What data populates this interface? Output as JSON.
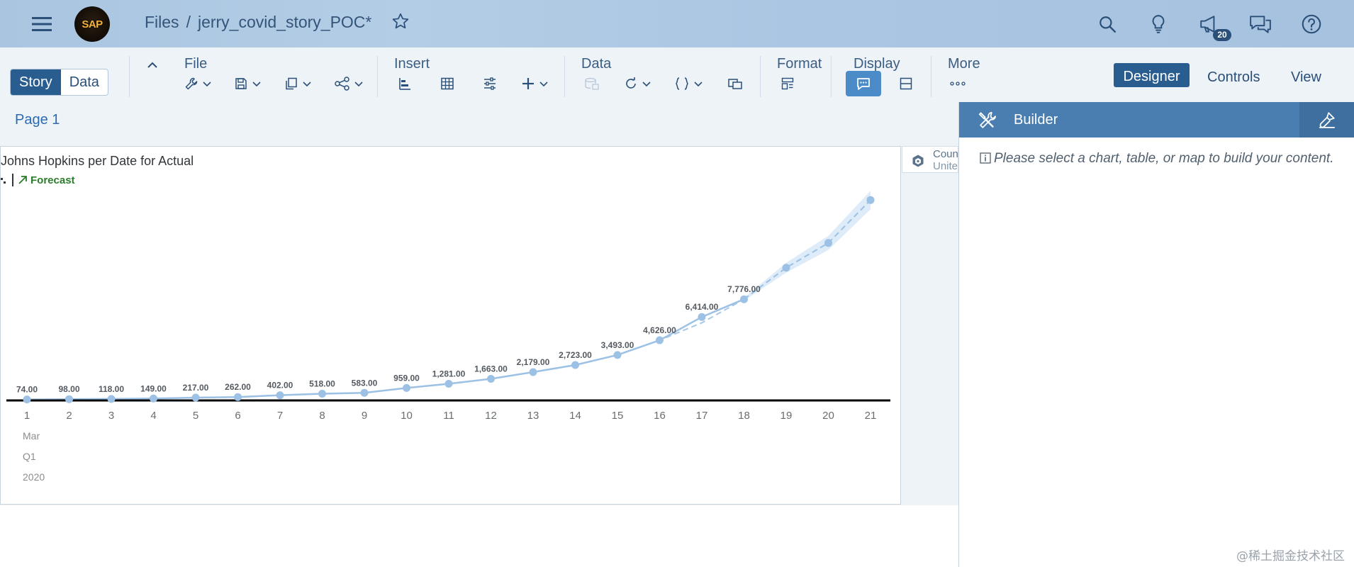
{
  "shell": {
    "logo_text": "SAP",
    "breadcrumb_root": "Files",
    "breadcrumb_sep": "/",
    "story_name": "jerry_covid_story_POC*",
    "notification_count": "20"
  },
  "toolbar": {
    "story_tab": "Story",
    "data_tab": "Data",
    "file_label": "File",
    "insert_label": "Insert",
    "data_label": "Data",
    "format_label": "Format",
    "display_label": "Display",
    "more_label": "More",
    "modes": {
      "designer": "Designer",
      "controls": "Controls",
      "view": "View"
    }
  },
  "page": {
    "tab_label": "Page 1"
  },
  "filter": {
    "label": "Coun",
    "value": "Unite"
  },
  "builder": {
    "title": "Builder",
    "info": "Please select a chart, table, or map to build your content."
  },
  "chart_data": {
    "type": "line",
    "title": "Johns Hopkins per Date for Actual",
    "forecast_label": "Forecast",
    "x": [
      "1",
      "2",
      "3",
      "4",
      "5",
      "6",
      "7",
      "8",
      "9",
      "10",
      "11",
      "12",
      "13",
      "14",
      "15",
      "16",
      "17",
      "18",
      "19",
      "20",
      "21"
    ],
    "x_group_labels": [
      "Mar",
      "Q1",
      "2020"
    ],
    "series": [
      {
        "name": "Actual",
        "values": [
          74,
          98,
          118,
          149,
          217,
          262,
          402,
          518,
          583,
          959,
          1281,
          1663,
          2179,
          2723,
          3493,
          4626,
          6414,
          7776
        ],
        "labels": [
          "74.00",
          "98.00",
          "118.00",
          "149.00",
          "217.00",
          "262.00",
          "402.00",
          "518.00",
          "583.00",
          "959.00",
          "1,281.00",
          "1,663.00",
          "2,179.00",
          "2,723.00",
          "3,493.00",
          "4,626.00",
          "6,414.00",
          "7,776.00"
        ]
      },
      {
        "name": "Forecast",
        "x": [
          "18",
          "19",
          "20",
          "21"
        ],
        "values": [
          7776,
          10200,
          12100,
          15400
        ]
      }
    ],
    "ylim": [
      0,
      16500
    ],
    "grid": false,
    "colors": {
      "line": "#9cc1e5",
      "point": "#9cc1e5",
      "band": "#d6e6f6",
      "baseline": "#000000",
      "forecast": "#2b7c2b"
    }
  },
  "watermark": "@稀土掘金技术社区"
}
